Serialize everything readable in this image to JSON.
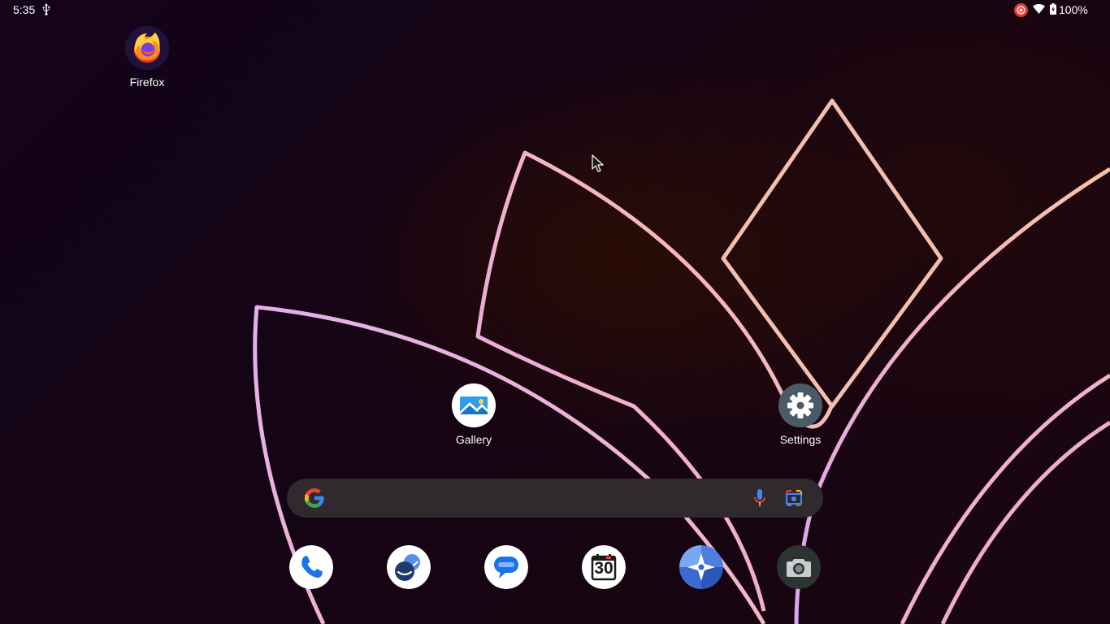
{
  "status_bar": {
    "time": "5:35",
    "battery": "100%",
    "icons": [
      "usb-icon",
      "screen-record-icon",
      "wifi-icon",
      "battery-icon"
    ]
  },
  "desktop": {
    "apps": [
      {
        "label": "Firefox",
        "icon": "firefox-icon"
      },
      {
        "label": "Gallery",
        "icon": "gallery-icon"
      },
      {
        "label": "Settings",
        "icon": "settings-gear-icon"
      }
    ]
  },
  "search": {
    "icons": [
      "google-g-icon",
      "microphone-icon",
      "google-lens-icon"
    ]
  },
  "dock": {
    "apps": [
      {
        "name": "Phone",
        "icon": "phone-icon"
      },
      {
        "name": "Contacts",
        "icon": "contacts-icon"
      },
      {
        "name": "Messages",
        "icon": "messages-icon"
      },
      {
        "name": "Calendar",
        "icon": "calendar-icon",
        "date": "30"
      },
      {
        "name": "Maps",
        "icon": "navigation-icon"
      },
      {
        "name": "Camera",
        "icon": "camera-icon"
      }
    ]
  },
  "colors": {
    "background": "#14031a",
    "petal_gradient": [
      "#d9a6f0",
      "#f4b6c9",
      "#f6c3a6"
    ],
    "search_bar": "#302a2e"
  }
}
